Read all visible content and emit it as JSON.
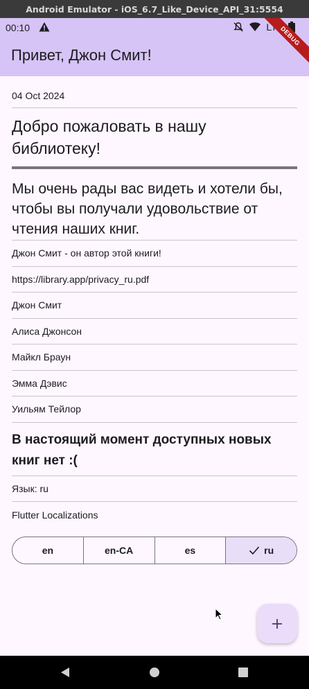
{
  "window": {
    "title": "Android Emulator - iOS_6.7_Like_Device_API_31:5554"
  },
  "status_bar": {
    "time": "00:10",
    "network": "LTE"
  },
  "app_bar": {
    "title": "Привет, Джон Смит!",
    "debug_banner": "DEBUG"
  },
  "content": {
    "date": "04 Oct 2024",
    "welcome": "Добро пожаловать в нашу библиотеку!",
    "intro": "Мы очень рады вас видеть и хотели бы, чтобы вы получали удовольствие от чтения наших книг.",
    "author_note": "Джон Смит - он автор этой книги!",
    "privacy_url": "https://library.app/privacy_ru.pdf",
    "users": [
      "Джон Смит",
      "Алиса Джонсон",
      "Майкл Браун",
      "Эмма Дэвис",
      "Уильям Тейлор"
    ],
    "no_books": "В настоящий момент доступных новых книг нет :(",
    "language": "Язык: ru",
    "localizations": "Flutter Localizations"
  },
  "locale_selector": {
    "options": [
      "en",
      "en-CA",
      "es",
      "ru"
    ],
    "selected": "ru"
  },
  "fab": {
    "icon": "plus-icon"
  },
  "colors": {
    "app_bar": "#d6c4f6",
    "background": "#fef7ff",
    "selected_segment": "#e8def8",
    "fab": "#ebdcf9"
  }
}
